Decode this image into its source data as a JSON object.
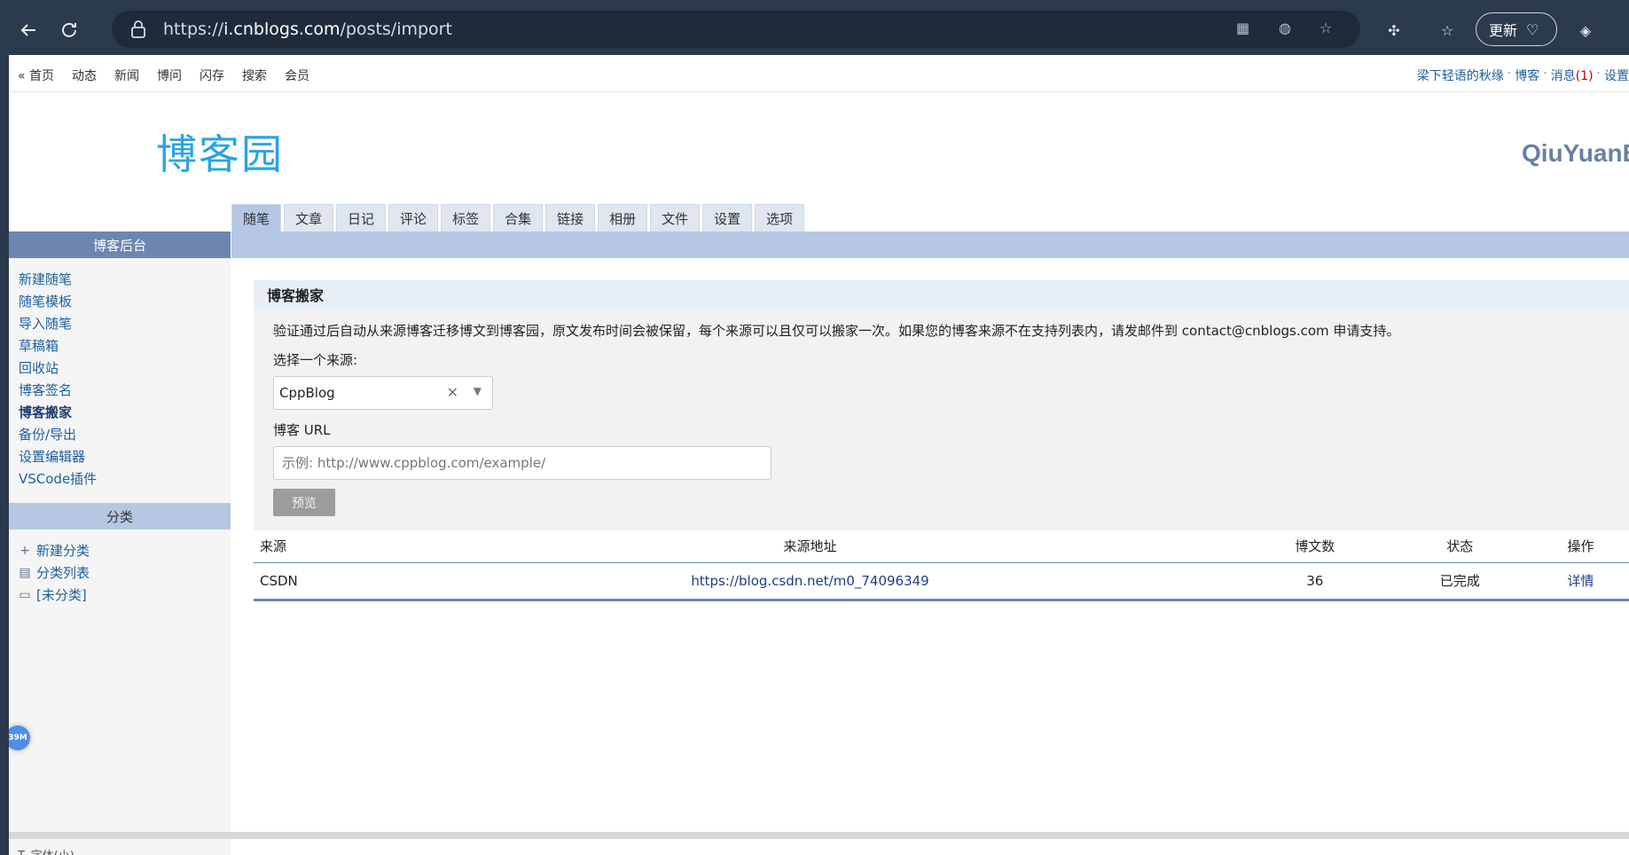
{
  "browser": {
    "url_prefix": "https://",
    "url_host": "i.cnblogs.com",
    "url_path": "/posts/import",
    "update_label": "更新"
  },
  "topnav": {
    "links": [
      "« 首页",
      "动态",
      "新闻",
      "博问",
      "闪存",
      "搜索",
      "会员"
    ],
    "user": "梁下轻语的秋缘",
    "blog": "博客",
    "messages": "消息",
    "message_count": "(1)",
    "settings": "设置"
  },
  "logo": "博客园",
  "username": "QiuYuanB",
  "tabs": [
    "随笔",
    "文章",
    "日记",
    "评论",
    "标签",
    "合集",
    "链接",
    "相册",
    "文件",
    "设置",
    "选项"
  ],
  "sidebar": {
    "header": "博客后台",
    "items": [
      "新建随笔",
      "随笔模板",
      "导入随笔",
      "草稿箱",
      "回收站",
      "博客签名",
      "博客搬家",
      "备份/导出",
      "设置编辑器",
      "VSCode插件"
    ],
    "category_header": "分类",
    "categories": [
      {
        "icon": "plus-icon",
        "label": "新建分类"
      },
      {
        "icon": "list-icon",
        "label": "分类列表"
      },
      {
        "icon": "folder-icon",
        "label": "[未分类]"
      }
    ],
    "memory_badge": "39M"
  },
  "import": {
    "title": "博客搬家",
    "description": "验证通过后自动从来源博客迁移博文到博客园，原文发布时间会被保留，每个来源可以且仅可以搬家一次。如果您的博客来源不在支持列表内，请发邮件到 contact@cnblogs.com 申请支持。",
    "source_label": "选择一个来源:",
    "source_value": "CppBlog",
    "url_label": "博客 URL",
    "url_placeholder": "示例: http://www.cppblog.com/example/",
    "preview_label": "预览"
  },
  "table": {
    "headers": [
      "来源",
      "来源地址",
      "博文数",
      "状态",
      "操作"
    ],
    "rows": [
      {
        "source": "CSDN",
        "address": "https://blog.csdn.net/m0_74096349",
        "count": "36",
        "status": "已完成",
        "action": "详情"
      }
    ]
  },
  "footer": {
    "left": "T. 字体(小)"
  }
}
